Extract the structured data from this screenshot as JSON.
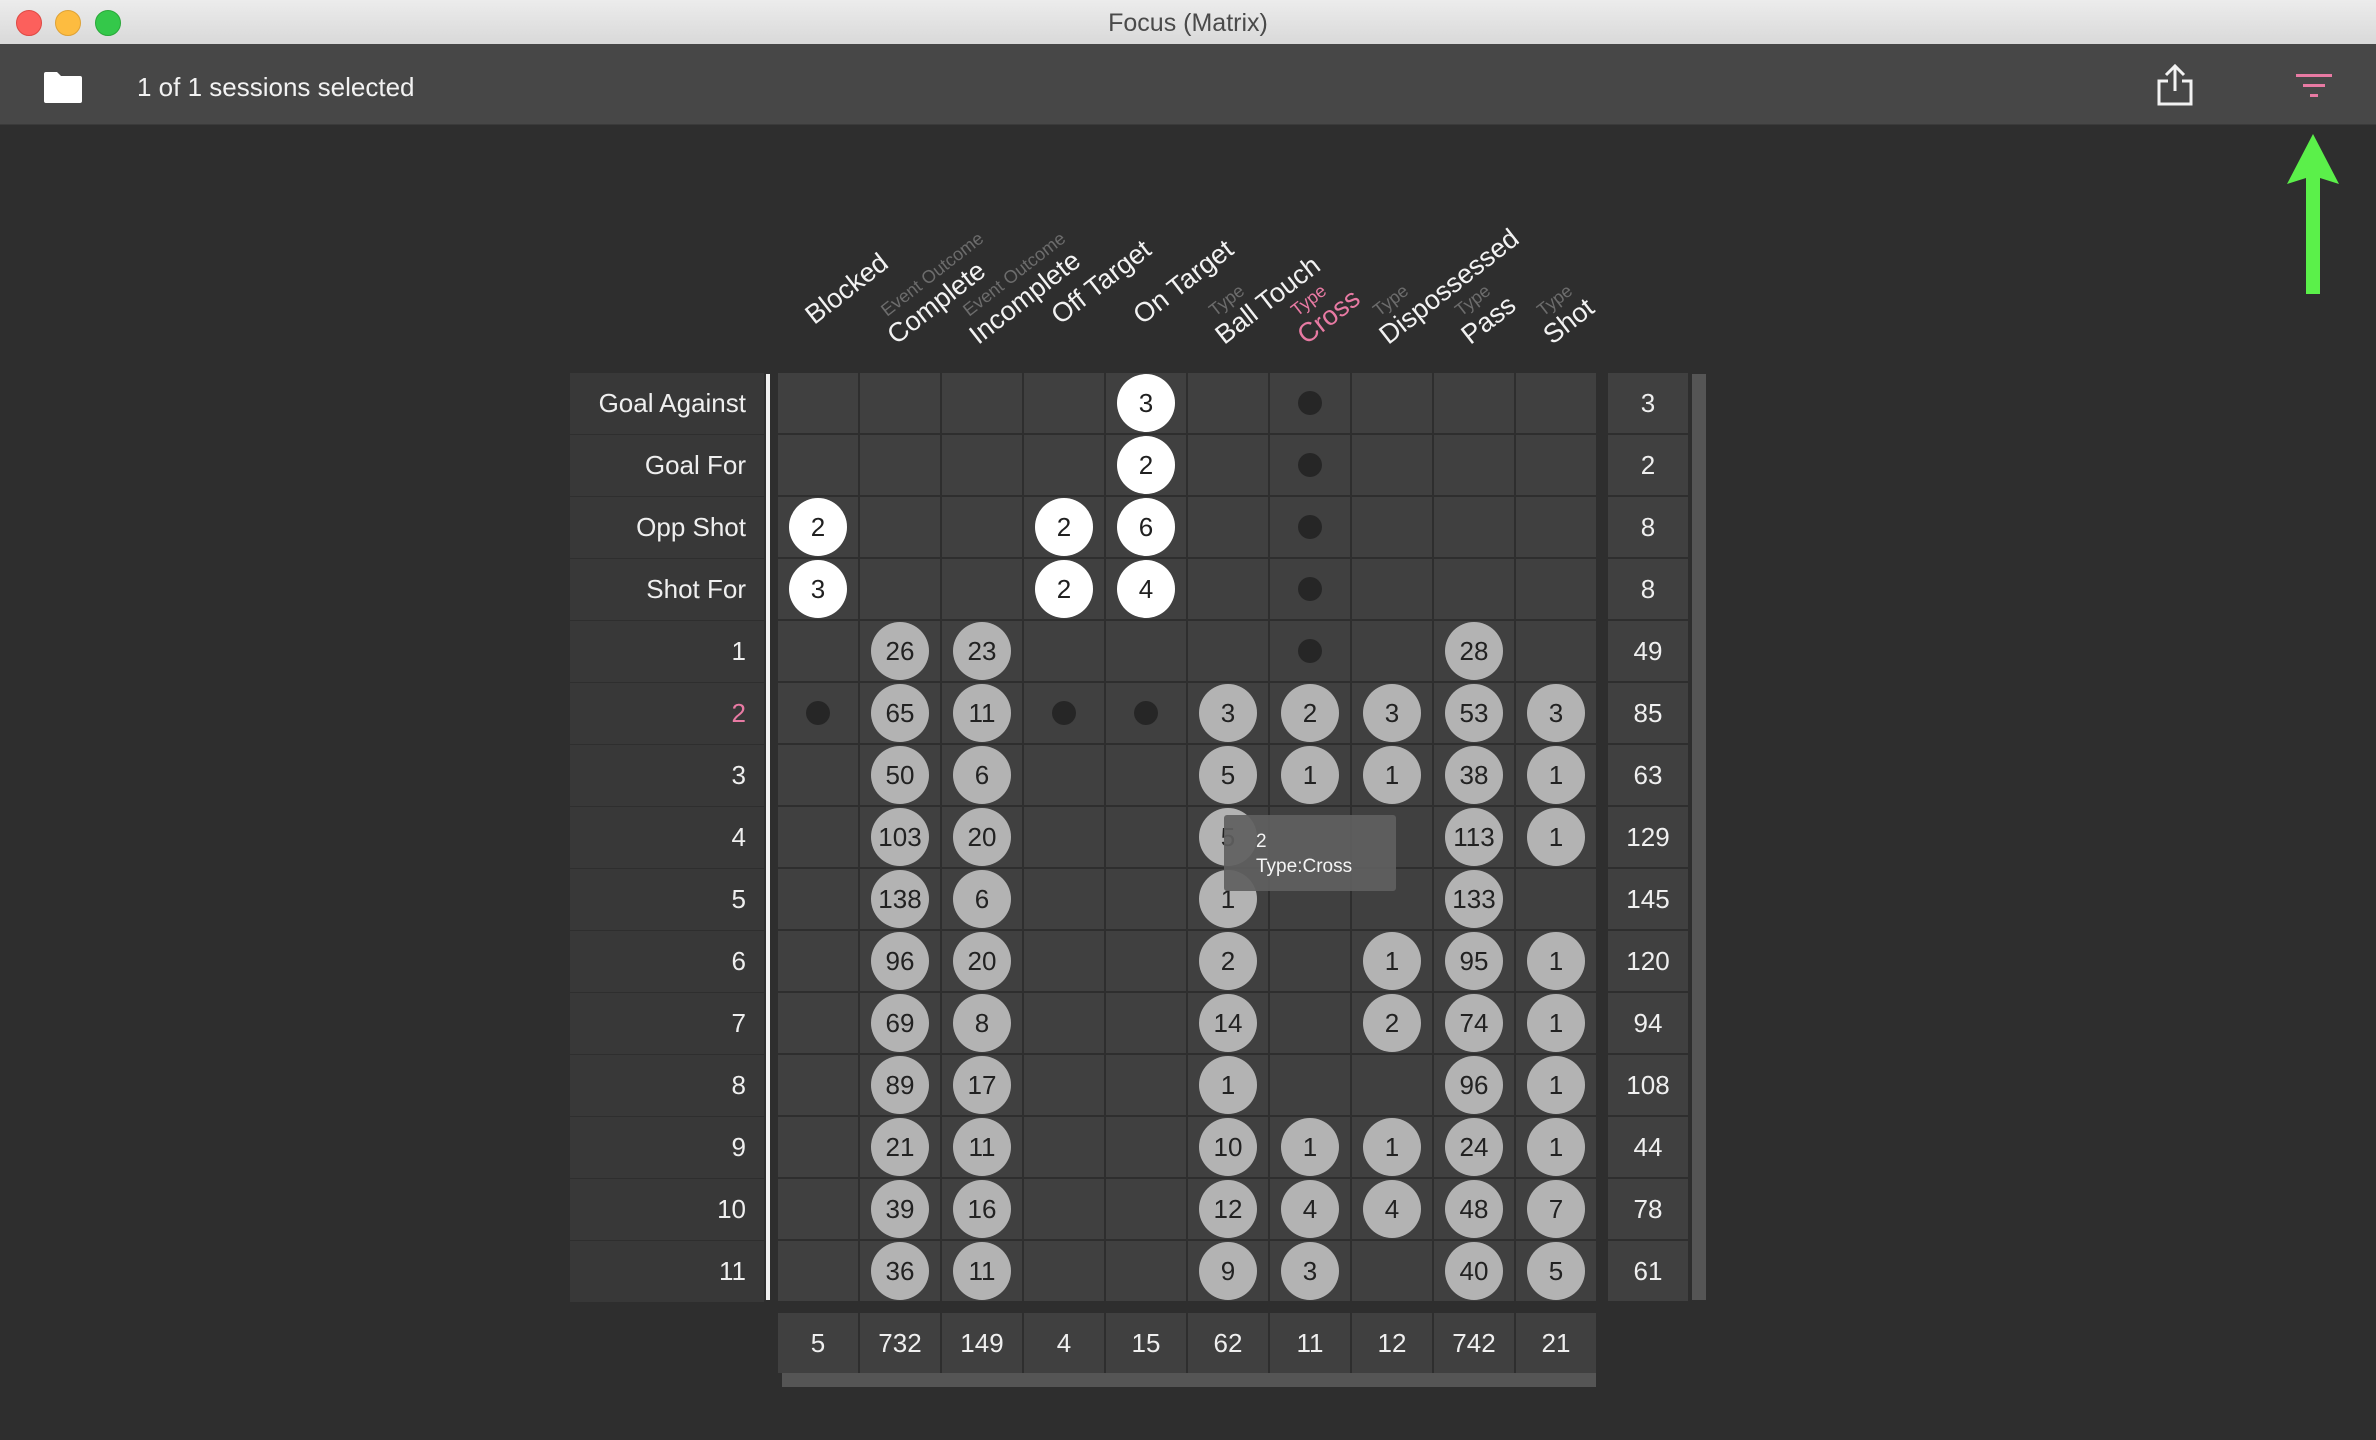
{
  "window": {
    "title": "Focus (Matrix)"
  },
  "toolbar": {
    "session_text": "1 of 1 sessions selected",
    "folder_icon": "folder-icon",
    "share_icon": "share-icon",
    "filter_icon": "filter-icon",
    "filter_color": "#e87aa3"
  },
  "annotation": {
    "arrow_color": "#5bf04a",
    "arrow_icon": "up-arrow-icon"
  },
  "columns": [
    {
      "sub": "",
      "label": "Blocked"
    },
    {
      "sub": "Event Outcome",
      "label": "Complete"
    },
    {
      "sub": "Event Outcome",
      "label": "Incomplete"
    },
    {
      "sub": "",
      "label": "Off Target"
    },
    {
      "sub": "",
      "label": "On Target"
    },
    {
      "sub": "Type",
      "label": "Ball Touch"
    },
    {
      "sub": "Type",
      "label": "Cross",
      "highlight": true
    },
    {
      "sub": "Type",
      "label": "Dispossessed"
    },
    {
      "sub": "Type",
      "label": "Pass"
    },
    {
      "sub": "Type",
      "label": "Shot"
    }
  ],
  "rows": [
    {
      "label": "Goal Against",
      "cells": [
        null,
        null,
        null,
        null,
        {
          "v": "3",
          "s": "white"
        },
        null,
        {
          "dot": true
        },
        null,
        null,
        null
      ],
      "total": "3"
    },
    {
      "label": "Goal For",
      "cells": [
        null,
        null,
        null,
        null,
        {
          "v": "2",
          "s": "white"
        },
        null,
        {
          "dot": true
        },
        null,
        null,
        null
      ],
      "total": "2"
    },
    {
      "label": "Opp Shot",
      "cells": [
        {
          "v": "2",
          "s": "white"
        },
        null,
        null,
        {
          "v": "2",
          "s": "white"
        },
        {
          "v": "6",
          "s": "white"
        },
        null,
        {
          "dot": true
        },
        null,
        null,
        null
      ],
      "total": "8"
    },
    {
      "label": "Shot For",
      "cells": [
        {
          "v": "3",
          "s": "white"
        },
        null,
        null,
        {
          "v": "2",
          "s": "white"
        },
        {
          "v": "4",
          "s": "white"
        },
        null,
        {
          "dot": true
        },
        null,
        null,
        null
      ],
      "total": "8"
    },
    {
      "label": "1",
      "cells": [
        null,
        {
          "v": "26",
          "s": "grey"
        },
        {
          "v": "23",
          "s": "grey"
        },
        null,
        null,
        null,
        {
          "dot": true
        },
        null,
        {
          "v": "28",
          "s": "grey"
        },
        null
      ],
      "total": "49"
    },
    {
      "label": "2",
      "highlight": true,
      "cells": [
        {
          "dot": true
        },
        {
          "v": "65",
          "s": "grey"
        },
        {
          "v": "11",
          "s": "grey"
        },
        {
          "dot": true
        },
        {
          "dot": true
        },
        {
          "v": "3",
          "s": "grey"
        },
        {
          "v": "2",
          "s": "grey"
        },
        {
          "v": "3",
          "s": "grey"
        },
        {
          "v": "53",
          "s": "grey"
        },
        {
          "v": "3",
          "s": "grey"
        }
      ],
      "total": "85"
    },
    {
      "label": "3",
      "cells": [
        null,
        {
          "v": "50",
          "s": "grey"
        },
        {
          "v": "6",
          "s": "grey"
        },
        null,
        null,
        {
          "v": "5",
          "s": "grey"
        },
        {
          "v": "1",
          "s": "grey"
        },
        {
          "v": "1",
          "s": "grey"
        },
        {
          "v": "38",
          "s": "grey"
        },
        {
          "v": "1",
          "s": "grey"
        }
      ],
      "total": "63"
    },
    {
      "label": "4",
      "cells": [
        null,
        {
          "v": "103",
          "s": "grey"
        },
        {
          "v": "20",
          "s": "grey"
        },
        null,
        null,
        {
          "v": "5",
          "s": "grey"
        },
        null,
        null,
        {
          "v": "113",
          "s": "grey"
        },
        {
          "v": "1",
          "s": "grey"
        }
      ],
      "total": "129"
    },
    {
      "label": "5",
      "cells": [
        null,
        {
          "v": "138",
          "s": "grey"
        },
        {
          "v": "6",
          "s": "grey"
        },
        null,
        null,
        {
          "v": "1",
          "s": "grey"
        },
        null,
        null,
        {
          "v": "133",
          "s": "grey"
        },
        null
      ],
      "total": "145"
    },
    {
      "label": "6",
      "cells": [
        null,
        {
          "v": "96",
          "s": "grey"
        },
        {
          "v": "20",
          "s": "grey"
        },
        null,
        null,
        {
          "v": "2",
          "s": "grey"
        },
        null,
        {
          "v": "1",
          "s": "grey"
        },
        {
          "v": "95",
          "s": "grey"
        },
        {
          "v": "1",
          "s": "grey"
        }
      ],
      "total": "120"
    },
    {
      "label": "7",
      "cells": [
        null,
        {
          "v": "69",
          "s": "grey"
        },
        {
          "v": "8",
          "s": "grey"
        },
        null,
        null,
        {
          "v": "14",
          "s": "grey"
        },
        null,
        {
          "v": "2",
          "s": "grey"
        },
        {
          "v": "74",
          "s": "grey"
        },
        {
          "v": "1",
          "s": "grey"
        }
      ],
      "total": "94"
    },
    {
      "label": "8",
      "cells": [
        null,
        {
          "v": "89",
          "s": "grey"
        },
        {
          "v": "17",
          "s": "grey"
        },
        null,
        null,
        {
          "v": "1",
          "s": "grey"
        },
        null,
        null,
        {
          "v": "96",
          "s": "grey"
        },
        {
          "v": "1",
          "s": "grey"
        }
      ],
      "total": "108"
    },
    {
      "label": "9",
      "cells": [
        null,
        {
          "v": "21",
          "s": "grey"
        },
        {
          "v": "11",
          "s": "grey"
        },
        null,
        null,
        {
          "v": "10",
          "s": "grey"
        },
        {
          "v": "1",
          "s": "grey"
        },
        {
          "v": "1",
          "s": "grey"
        },
        {
          "v": "24",
          "s": "grey"
        },
        {
          "v": "1",
          "s": "grey"
        }
      ],
      "total": "44"
    },
    {
      "label": "10",
      "cells": [
        null,
        {
          "v": "39",
          "s": "grey"
        },
        {
          "v": "16",
          "s": "grey"
        },
        null,
        null,
        {
          "v": "12",
          "s": "grey"
        },
        {
          "v": "4",
          "s": "grey"
        },
        {
          "v": "4",
          "s": "grey"
        },
        {
          "v": "48",
          "s": "grey"
        },
        {
          "v": "7",
          "s": "grey"
        }
      ],
      "total": "78"
    },
    {
      "label": "11",
      "cells": [
        null,
        {
          "v": "36",
          "s": "grey"
        },
        {
          "v": "11",
          "s": "grey"
        },
        null,
        null,
        {
          "v": "9",
          "s": "grey"
        },
        {
          "v": "3",
          "s": "grey"
        },
        null,
        {
          "v": "40",
          "s": "grey"
        },
        {
          "v": "5",
          "s": "grey"
        }
      ],
      "total": "61"
    }
  ],
  "column_totals": [
    "5",
    "732",
    "149",
    "4",
    "15",
    "62",
    "11",
    "12",
    "742",
    "21"
  ],
  "tooltip": {
    "line1": "2",
    "line2": "Type:Cross"
  },
  "colors": {
    "highlight": "#e87aa3",
    "background": "#2e2e2e"
  }
}
